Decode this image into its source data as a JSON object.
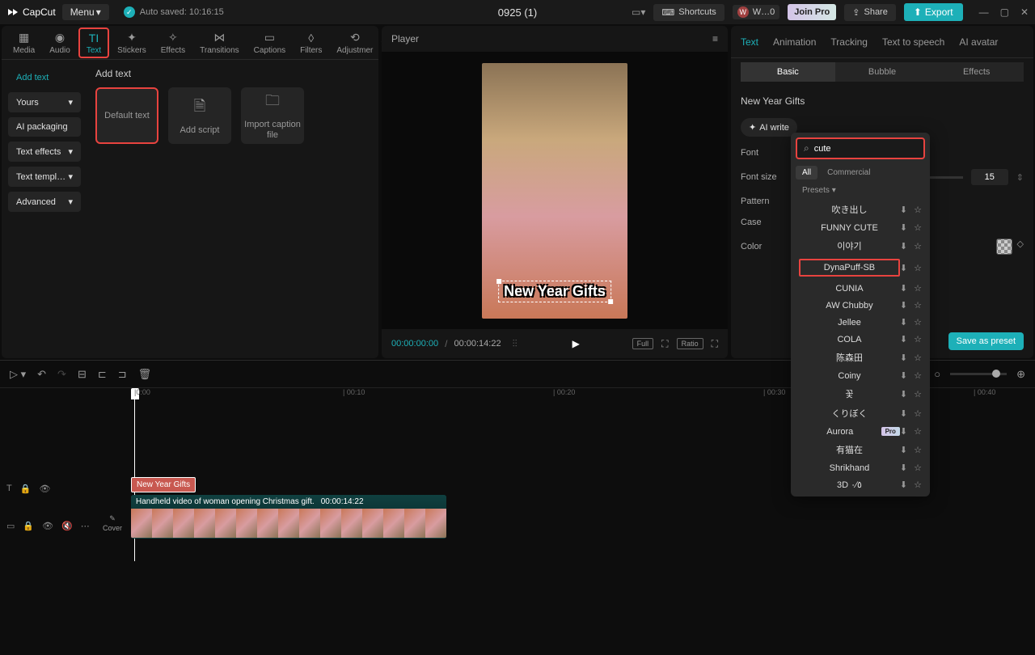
{
  "titlebar": {
    "logo": "CapCut",
    "menu": "Menu",
    "autosave": "Auto saved: 10:16:15",
    "project": "0925 (1)",
    "shortcuts": "Shortcuts",
    "user_badge": "W…0",
    "join_pro": "Join Pro",
    "share": "Share",
    "export": "Export"
  },
  "left_toolbar": [
    {
      "label": "Media"
    },
    {
      "label": "Audio"
    },
    {
      "label": "Text"
    },
    {
      "label": "Stickers"
    },
    {
      "label": "Effects"
    },
    {
      "label": "Transitions"
    },
    {
      "label": "Captions"
    },
    {
      "label": "Filters"
    },
    {
      "label": "Adjustmer"
    }
  ],
  "left_sidebar": {
    "items": [
      "Add text",
      "Yours",
      "AI packaging",
      "Text effects",
      "Text templ…",
      "Advanced"
    ],
    "header": "Add text"
  },
  "text_options": [
    "Default text",
    "Add script",
    "Import caption file"
  ],
  "player": {
    "title": "Player",
    "overlay_text": "New Year Gifts",
    "time_current": "00:00:00:00",
    "time_end": "00:00:14:22",
    "full": "Full",
    "ratio": "Ratio"
  },
  "right_tabs": [
    "Text",
    "Animation",
    "Tracking",
    "Text to speech",
    "AI avatar"
  ],
  "right_subtabs": [
    "Basic",
    "Bubble",
    "Effects"
  ],
  "text_props": {
    "text_value": "New Year Gifts",
    "ai_write": "AI write",
    "font_label": "Font",
    "fontsize_label": "Font size",
    "fontsize_value": "15",
    "pattern_label": "Pattern",
    "case_label": "Case",
    "color_label": "Color",
    "save_preset": "Save as preset"
  },
  "font_dropdown": {
    "search_value": "cute",
    "tabs": [
      "All",
      "Commercial"
    ],
    "presets": "Presets",
    "fonts": [
      {
        "name": "吹き出し"
      },
      {
        "name": "FUNNY CUTE"
      },
      {
        "name": "이야기"
      },
      {
        "name": "DynaPuff-SB",
        "highlight": true
      },
      {
        "name": "CUNIA"
      },
      {
        "name": "AW Chubby"
      },
      {
        "name": "Jellee"
      },
      {
        "name": "COLA"
      },
      {
        "name": "陈森田"
      },
      {
        "name": "Coiny"
      },
      {
        "name": "꽃"
      },
      {
        "name": "くりぼく"
      },
      {
        "name": "Aurora",
        "pro": true
      },
      {
        "name": "有猫在"
      },
      {
        "name": "Shrikhand"
      },
      {
        "name": "3D ٥∕٠"
      }
    ]
  },
  "timeline": {
    "ticks": [
      "|0:00",
      "| 00:10",
      "| 00:20",
      "| 00:30",
      "| 00:40"
    ],
    "text_clip": "New Year Gifts",
    "video_label": "Handheld video of woman opening Christmas gift.",
    "video_time": "00:00:14:22",
    "cover": "Cover"
  }
}
